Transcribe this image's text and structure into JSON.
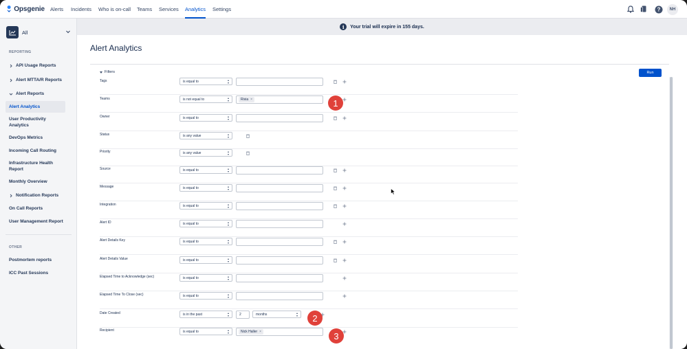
{
  "app": {
    "name": "Opsgenie"
  },
  "nav": {
    "items": [
      {
        "label": "Alerts"
      },
      {
        "label": "Incidents"
      },
      {
        "label": "Who is on-call"
      },
      {
        "label": "Teams"
      },
      {
        "label": "Services"
      },
      {
        "label": "Analytics",
        "active": true
      },
      {
        "label": "Settings"
      }
    ],
    "icons": [
      "notification-bell-icon",
      "mobile-app-icon",
      "help-icon"
    ],
    "avatar": "NH"
  },
  "sidebar": {
    "team": "All",
    "reporting_heading": "REPORTING",
    "items": [
      {
        "label": "API Usage Reports"
      },
      {
        "label": "Alert MTTA/R Reports"
      },
      {
        "label": "Alert Reports"
      },
      {
        "label": "Alert Analytics"
      },
      {
        "label": "User Productivity Analytics"
      },
      {
        "label": "DevOps Metrics"
      },
      {
        "label": "Incoming Call Routing"
      },
      {
        "label": "Infrastructure Health Report"
      },
      {
        "label": "Monthly Overview"
      },
      {
        "label": "Notification Reports"
      },
      {
        "label": "On Call Reports"
      },
      {
        "label": "User Management Report"
      }
    ],
    "other_heading": "OTHER",
    "other_items": [
      {
        "label": "Postmortem reports"
      },
      {
        "label": "ICC Past Sessions"
      }
    ]
  },
  "banner": {
    "icon": "info-icon",
    "text": "Your trial will expire in 155 days."
  },
  "page": {
    "title": "Alert Analytics",
    "filters_label": "Filters",
    "run_label": "Run"
  },
  "filters": [
    {
      "label": "Tags",
      "op": "is equal to"
    },
    {
      "label": "Teams",
      "op": "is not equal to",
      "tag": "Rivia"
    },
    {
      "label": "Owner",
      "op": "is equal to"
    },
    {
      "label": "Status",
      "op": "is any value"
    },
    {
      "label": "Priority",
      "op": "is any value"
    },
    {
      "label": "Source",
      "op": "is equal to"
    },
    {
      "label": "Message",
      "op": "is equal to"
    },
    {
      "label": "Integration",
      "op": "is equal to"
    },
    {
      "label": "Alert ID",
      "op": "is equal to"
    },
    {
      "label": "Alert Details Key",
      "op": "is equal to"
    },
    {
      "label": "Alert Details Value",
      "op": "is equal to"
    },
    {
      "label": "Elapsed Time to Acknowledge (sec)",
      "op": "is equal to"
    },
    {
      "label": "Elapsed Time To Close (sec)",
      "op": "is equal to"
    },
    {
      "label": "Date Created",
      "op": "is in the past",
      "amount": "2",
      "unit": "months"
    },
    {
      "label": "Recipient",
      "op": "is equal to",
      "tag": "Nick Haller"
    }
  ],
  "callouts": [
    "1",
    "2",
    "3"
  ],
  "colors": {
    "accent": "#0052cc",
    "callout": "#e0413a",
    "sidebar_bg": "#f4f5f7"
  }
}
